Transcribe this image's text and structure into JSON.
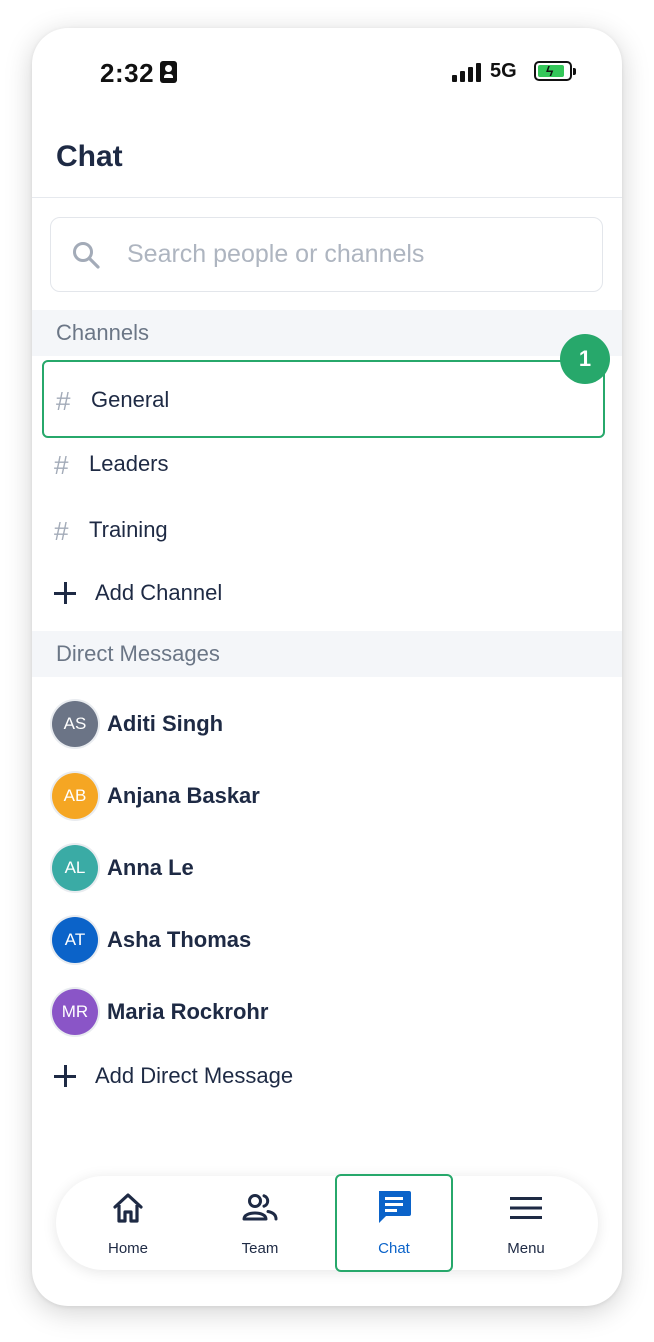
{
  "status_bar": {
    "time": "2:32",
    "network": "5G"
  },
  "header": {
    "title": "Chat"
  },
  "search": {
    "placeholder": "Search people or channels",
    "value": ""
  },
  "channels": {
    "section_label": "Channels",
    "items": [
      {
        "label": "General",
        "badge": "1"
      },
      {
        "label": "Leaders"
      },
      {
        "label": "Training"
      }
    ],
    "add_label": "Add Channel"
  },
  "direct_messages": {
    "section_label": "Direct Messages",
    "items": [
      {
        "initials": "AS",
        "name": "Aditi Singh",
        "color": "#6b7486"
      },
      {
        "initials": "AB",
        "name": "Anjana Baskar",
        "color": "#f5a623"
      },
      {
        "initials": "AL",
        "name": "Anna Le",
        "color": "#3aaba5"
      },
      {
        "initials": "AT",
        "name": "Asha Thomas",
        "color": "#0b63c9"
      },
      {
        "initials": "MR",
        "name": "Maria Rockrohr",
        "color": "#8a55c7"
      }
    ],
    "add_label": "Add Direct Message"
  },
  "bottom_nav": {
    "items": [
      {
        "label": "Home",
        "icon": "home-icon"
      },
      {
        "label": "Team",
        "icon": "team-icon"
      },
      {
        "label": "Chat",
        "icon": "chat-icon",
        "active": true
      },
      {
        "label": "Menu",
        "icon": "menu-icon"
      }
    ]
  },
  "colors": {
    "accent": "#27a86b",
    "primary": "#0b63c9",
    "text": "#1e2a44"
  }
}
